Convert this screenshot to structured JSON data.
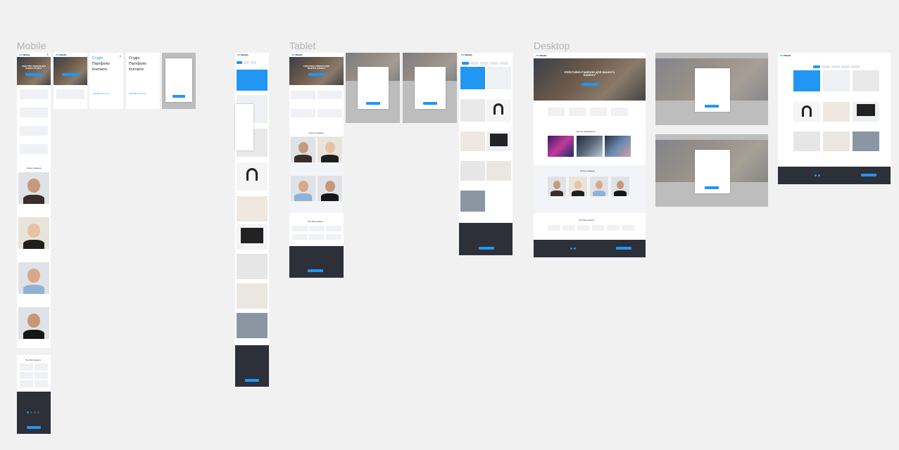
{
  "sections": {
    "mobile": "Mobile",
    "tablet": "Tablet",
    "desktop": "Desktop"
  },
  "brand": {
    "logo_prefix": "Web",
    "logo_suffix": "Studio"
  },
  "hero": {
    "title": "ЕФЕКТИВНІ РІШЕННЯ ДЛЯ ВАШОГО БІЗНЕСУ",
    "title_mobile": "ЕФЕКТИВНІ РІШЕННЯ ДЛЯ ВАШОГО БІЗНЕСУ"
  },
  "mobile_menu": {
    "items": [
      "Студія",
      "Портфоліо",
      "Контакти"
    ],
    "phone": "+38 096 111 11 11"
  },
  "headings": {
    "team": "Наша команда",
    "clients": "Постійні клієнти",
    "why": "Чим ми займаємось"
  },
  "colors": {
    "accent": "#2196f3",
    "dark": "#2d2f39",
    "background": "#f1f1f1"
  }
}
